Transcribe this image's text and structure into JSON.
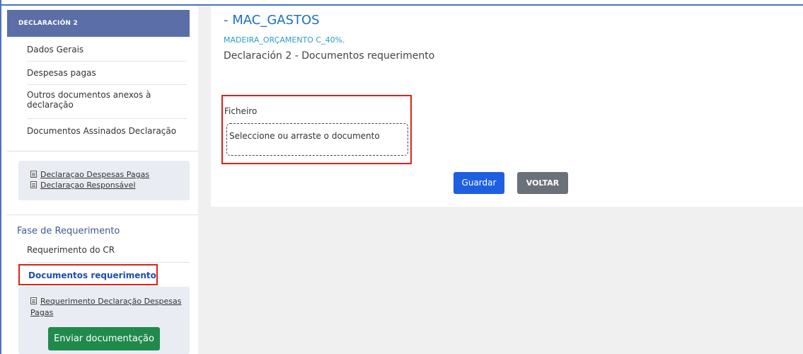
{
  "sidebar": {
    "header": "DECLARACIÓN 2",
    "items": [
      {
        "label": "Dados Gerais"
      },
      {
        "label": "Despesas pagas"
      },
      {
        "label": "Outros documentos anexos à declaração",
        "line1": "Outros documentos anexos à",
        "line2": "declaração"
      },
      {
        "label": "Documentos Assinados Declaração"
      }
    ],
    "declaration_links": [
      "Declaraçao Despesas Pagas ",
      "Declaraçao Responsável "
    ],
    "phase_title": "Fase de Requerimento",
    "phase_items": [
      {
        "label": "Requerimento do CR"
      },
      {
        "label": "Documentos requerimento"
      }
    ],
    "req_link_line1": "Requerimento Declaração Despesas",
    "req_link_line2": "Pagas ",
    "send_button": "Enviar documentação"
  },
  "main": {
    "title": "- MAC_GASTOS",
    "subtitle": "MADEIRA_ORÇAMENTO C_40%.",
    "heading": "Declaración 2 - Documentos requerimento",
    "file_label": "Ficheiro",
    "dropzone_text": "Seleccione ou arraste o documento",
    "save_button": "Guardar",
    "back_button": "VOLTAR"
  },
  "colors": {
    "accent_blue": "#1e5fe0",
    "header_bg": "#5b6fa6",
    "highlight_red": "#e0201b",
    "send_green": "#1f8a4c",
    "back_gray": "#6b7178"
  },
  "icons": [
    "document-icon"
  ]
}
